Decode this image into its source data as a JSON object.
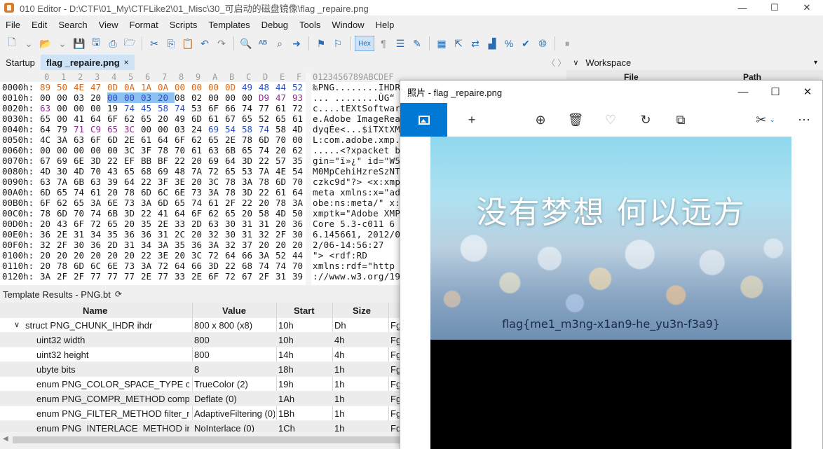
{
  "window": {
    "title": "010 Editor - D:\\CTF\\01_My\\CTFLike2\\01_Misc\\30_可启动的磁盘镜像\\flag _repaire.png",
    "minimize": "—",
    "maximize": "☐",
    "close": "✕"
  },
  "menu": [
    "File",
    "Edit",
    "Search",
    "View",
    "Format",
    "Scripts",
    "Templates",
    "Debug",
    "Tools",
    "Window",
    "Help"
  ],
  "toolbar": {
    "hex_label": "Hex"
  },
  "tabs": [
    {
      "label": "Startup"
    },
    {
      "label": "flag _repaire.png",
      "close": "×"
    }
  ],
  "workspace": {
    "nav": "〈 〉",
    "chevron": "∨",
    "label": "Workspace",
    "dropdown": "▾",
    "col_file": "File",
    "col_path": "Path"
  },
  "hex": {
    "header_cols": [
      "0",
      "1",
      "2",
      "3",
      "4",
      "5",
      "6",
      "7",
      "8",
      "9",
      "A",
      "B",
      "C",
      "D",
      "E",
      "F"
    ],
    "header_ascii": "0123456789ABCDEF",
    "rows": [
      {
        "addr": "0000h:",
        "bytes": [
          "89",
          "50",
          "4E",
          "47",
          "0D",
          "0A",
          "1A",
          "0A",
          "00",
          "00",
          "00",
          "0D",
          "49",
          "48",
          "44",
          "52"
        ],
        "ascii": "‰PNG........IHDR"
      },
      {
        "addr": "0010h:",
        "bytes": [
          "00",
          "00",
          "03",
          "20",
          "00",
          "00",
          "03",
          "20",
          "08",
          "02",
          "00",
          "00",
          "00",
          "D9",
          "47",
          "93"
        ],
        "ascii": "... ........ÙG“"
      },
      {
        "addr": "0020h:",
        "bytes": [
          "63",
          "00",
          "00",
          "00",
          "19",
          "74",
          "45",
          "58",
          "74",
          "53",
          "6F",
          "66",
          "74",
          "77",
          "61",
          "72"
        ],
        "ascii": "c....tEXtSoftwar"
      },
      {
        "addr": "0030h:",
        "bytes": [
          "65",
          "00",
          "41",
          "64",
          "6F",
          "62",
          "65",
          "20",
          "49",
          "6D",
          "61",
          "67",
          "65",
          "52",
          "65",
          "61"
        ],
        "ascii": "e.Adobe ImageRea"
      },
      {
        "addr": "0040h:",
        "bytes": [
          "64",
          "79",
          "71",
          "C9",
          "65",
          "3C",
          "00",
          "00",
          "03",
          "24",
          "69",
          "54",
          "58",
          "74",
          "58",
          "4D"
        ],
        "ascii": "dyqÉe<...$iTXtXM"
      },
      {
        "addr": "0050h:",
        "bytes": [
          "4C",
          "3A",
          "63",
          "6F",
          "6D",
          "2E",
          "61",
          "64",
          "6F",
          "62",
          "65",
          "2E",
          "78",
          "6D",
          "70",
          "00"
        ],
        "ascii": "L:com.adobe.xmp."
      },
      {
        "addr": "0060h:",
        "bytes": [
          "00",
          "00",
          "00",
          "00",
          "00",
          "3C",
          "3F",
          "78",
          "70",
          "61",
          "63",
          "6B",
          "65",
          "74",
          "20",
          "62"
        ],
        "ascii": ".....<?xpacket b"
      },
      {
        "addr": "0070h:",
        "bytes": [
          "67",
          "69",
          "6E",
          "3D",
          "22",
          "EF",
          "BB",
          "BF",
          "22",
          "20",
          "69",
          "64",
          "3D",
          "22",
          "57",
          "35"
        ],
        "ascii": "gin=\"ï»¿\" id=\"W5"
      },
      {
        "addr": "0080h:",
        "bytes": [
          "4D",
          "30",
          "4D",
          "70",
          "43",
          "65",
          "68",
          "69",
          "48",
          "7A",
          "72",
          "65",
          "53",
          "7A",
          "4E",
          "54"
        ],
        "ascii": "M0MpCehiHzreSzNT"
      },
      {
        "addr": "0090h:",
        "bytes": [
          "63",
          "7A",
          "6B",
          "63",
          "39",
          "64",
          "22",
          "3F",
          "3E",
          "20",
          "3C",
          "78",
          "3A",
          "78",
          "6D",
          "70"
        ],
        "ascii": "czkc9d\"?> <x:xmp"
      },
      {
        "addr": "00A0h:",
        "bytes": [
          "6D",
          "65",
          "74",
          "61",
          "20",
          "78",
          "6D",
          "6C",
          "6E",
          "73",
          "3A",
          "78",
          "3D",
          "22",
          "61",
          "64"
        ],
        "ascii": "meta xmlns:x=\"ad"
      },
      {
        "addr": "00B0h:",
        "bytes": [
          "6F",
          "62",
          "65",
          "3A",
          "6E",
          "73",
          "3A",
          "6D",
          "65",
          "74",
          "61",
          "2F",
          "22",
          "20",
          "78",
          "3A"
        ],
        "ascii": "obe:ns:meta/\" x:"
      },
      {
        "addr": "00C0h:",
        "bytes": [
          "78",
          "6D",
          "70",
          "74",
          "6B",
          "3D",
          "22",
          "41",
          "64",
          "6F",
          "62",
          "65",
          "20",
          "58",
          "4D",
          "50"
        ],
        "ascii": "xmptk=\"Adobe XMP"
      },
      {
        "addr": "00D0h:",
        "bytes": [
          "20",
          "43",
          "6F",
          "72",
          "65",
          "20",
          "35",
          "2E",
          "33",
          "2D",
          "63",
          "30",
          "31",
          "31",
          "20",
          "36"
        ],
        "ascii": " Core 5.3-c011 6"
      },
      {
        "addr": "00E0h:",
        "bytes": [
          "36",
          "2E",
          "31",
          "34",
          "35",
          "36",
          "36",
          "31",
          "2C",
          "20",
          "32",
          "30",
          "31",
          "32",
          "2F",
          "30"
        ],
        "ascii": "6.145661, 2012/0"
      },
      {
        "addr": "00F0h:",
        "bytes": [
          "32",
          "2F",
          "30",
          "36",
          "2D",
          "31",
          "34",
          "3A",
          "35",
          "36",
          "3A",
          "32",
          "37",
          "20",
          "20",
          "20"
        ],
        "ascii": "2/06-14:56:27   "
      },
      {
        "addr": "0100h:",
        "bytes": [
          "20",
          "20",
          "20",
          "20",
          "20",
          "20",
          "22",
          "3E",
          "20",
          "3C",
          "72",
          "64",
          "66",
          "3A",
          "52",
          "44"
        ],
        "ascii": "      \"> <rdf:RD"
      },
      {
        "addr": "0110h:",
        "bytes": [
          "20",
          "78",
          "6D",
          "6C",
          "6E",
          "73",
          "3A",
          "72",
          "64",
          "66",
          "3D",
          "22",
          "68",
          "74",
          "74",
          "70"
        ],
        "ascii": " xmlns:rdf=\"http"
      },
      {
        "addr": "0120h:",
        "bytes": [
          "3A",
          "2F",
          "2F",
          "77",
          "77",
          "77",
          "2E",
          "77",
          "33",
          "2E",
          "6F",
          "72",
          "67",
          "2F",
          "31",
          "39"
        ],
        "ascii": "://www.w3.org/19"
      }
    ],
    "colors": {
      "signature": "#d2691e",
      "ihdr_len": "#d2691e",
      "chunk_type": "#2b4fbf",
      "crc": "#8b2f8b",
      "selection": "#8cc1f2"
    }
  },
  "template_results": {
    "title": "Template Results - PNG.bt",
    "refresh": "⟳",
    "columns": [
      "Name",
      "Value",
      "Start",
      "Size",
      "Fg"
    ],
    "rows": [
      {
        "name": "struct PNG_CHUNK_IHDR ihdr",
        "value": "800 x 800 (x8)",
        "start": "10h",
        "size": "Dh",
        "fg": "Fg",
        "indent": 0,
        "expander": "∨"
      },
      {
        "name": "uint32 width",
        "value": "800",
        "start": "10h",
        "size": "4h",
        "fg": "Fg",
        "indent": 1
      },
      {
        "name": "uint32 height",
        "value": "800",
        "start": "14h",
        "size": "4h",
        "fg": "Fg",
        "indent": 1
      },
      {
        "name": "ubyte bits",
        "value": "8",
        "start": "18h",
        "size": "1h",
        "fg": "Fg",
        "indent": 1
      },
      {
        "name": "enum PNG_COLOR_SPACE_TYPE col...",
        "value": "TrueColor (2)",
        "start": "19h",
        "size": "1h",
        "fg": "Fg",
        "indent": 1
      },
      {
        "name": "enum PNG_COMPR_METHOD comp...",
        "value": "Deflate (0)",
        "start": "1Ah",
        "size": "1h",
        "fg": "Fg",
        "indent": 1
      },
      {
        "name": "enum PNG_FILTER_METHOD filter_m...",
        "value": "AdaptiveFiltering (0)",
        "start": "1Bh",
        "size": "1h",
        "fg": "Fg",
        "indent": 1
      },
      {
        "name": "enum PNG_INTERLACE_METHOD int...",
        "value": "NoInterlace (0)",
        "start": "1Ch",
        "size": "1h",
        "fg": "Fg",
        "indent": 1
      }
    ]
  },
  "photos": {
    "title": "照片 - flag _repaire.png",
    "minimize": "—",
    "maximize": "☐",
    "close": "✕",
    "tools": {
      "add": "+",
      "zoom": "⊕",
      "delete": "🗑",
      "favorite": "♡",
      "rotate": "↻",
      "crop": "⧉",
      "edit": "✂",
      "edit_dropdown": "⌄",
      "more": "⋯"
    },
    "image_caption": "没有梦想 何以远方",
    "image_flag": "flag{me1_m3ng-x1an9-he_yu3n-f3a9}"
  }
}
